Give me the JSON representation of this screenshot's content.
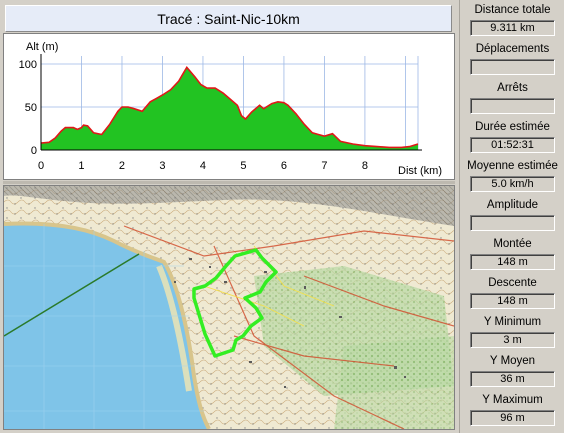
{
  "title": "Tracé : Saint-Nic-10km",
  "chart_data": {
    "type": "area",
    "ylabel": "Alt (m)",
    "xlabel": "Dist (km)",
    "xlim": [
      0,
      9.311
    ],
    "ylim": [
      0,
      100
    ],
    "x_ticks": [
      "0",
      "1",
      "2",
      "3",
      "4",
      "5",
      "6",
      "7",
      "8"
    ],
    "y_ticks": [
      "100",
      "50",
      "0"
    ],
    "grid": true,
    "fill_color": "#22c322",
    "line_color": "#e01818",
    "x": [
      0,
      0.2,
      0.35,
      0.5,
      0.6,
      0.8,
      0.9,
      1.0,
      1.05,
      1.15,
      1.3,
      1.5,
      1.7,
      1.9,
      2.0,
      2.15,
      2.3,
      2.5,
      2.7,
      2.85,
      3.0,
      3.2,
      3.4,
      3.5,
      3.6,
      3.8,
      3.95,
      4.1,
      4.3,
      4.5,
      4.65,
      4.85,
      4.95,
      5.05,
      5.2,
      5.4,
      5.5,
      5.7,
      5.85,
      6.0,
      6.1,
      6.3,
      6.5,
      6.7,
      6.85,
      7.0,
      7.2,
      7.4,
      7.7,
      8.0,
      8.3,
      8.6,
      8.9,
      9.1,
      9.311
    ],
    "y": [
      8,
      9,
      14,
      22,
      26,
      26,
      24,
      26,
      29,
      28,
      20,
      18,
      30,
      45,
      50,
      50,
      48,
      45,
      56,
      60,
      64,
      70,
      80,
      88,
      96,
      85,
      76,
      72,
      72,
      66,
      60,
      52,
      40,
      36,
      44,
      52,
      48,
      54,
      56,
      55,
      52,
      42,
      30,
      20,
      18,
      16,
      19,
      10,
      7,
      5,
      4,
      3,
      3,
      4,
      7
    ]
  },
  "map": {
    "trace_color": "#33ee22",
    "sea_color": "#7fc4e8"
  },
  "stats": [
    {
      "label": "Distance totale",
      "value": "9.311 km"
    },
    {
      "label": "Déplacements",
      "value": ""
    },
    {
      "label": "Arrêts",
      "value": ""
    },
    {
      "label": "Durée estimée",
      "value": "01:52:31"
    },
    {
      "label": "Moyenne estimée",
      "value": "5.0 km/h"
    },
    {
      "label": "Amplitude",
      "value": ""
    },
    {
      "label": "Montée",
      "value": "148 m"
    },
    {
      "label": "Descente",
      "value": "148 m"
    },
    {
      "label": "Y Minimum",
      "value": "3 m"
    },
    {
      "label": "Y Moyen",
      "value": "36 m"
    },
    {
      "label": "Y Maximum",
      "value": "96 m"
    }
  ]
}
